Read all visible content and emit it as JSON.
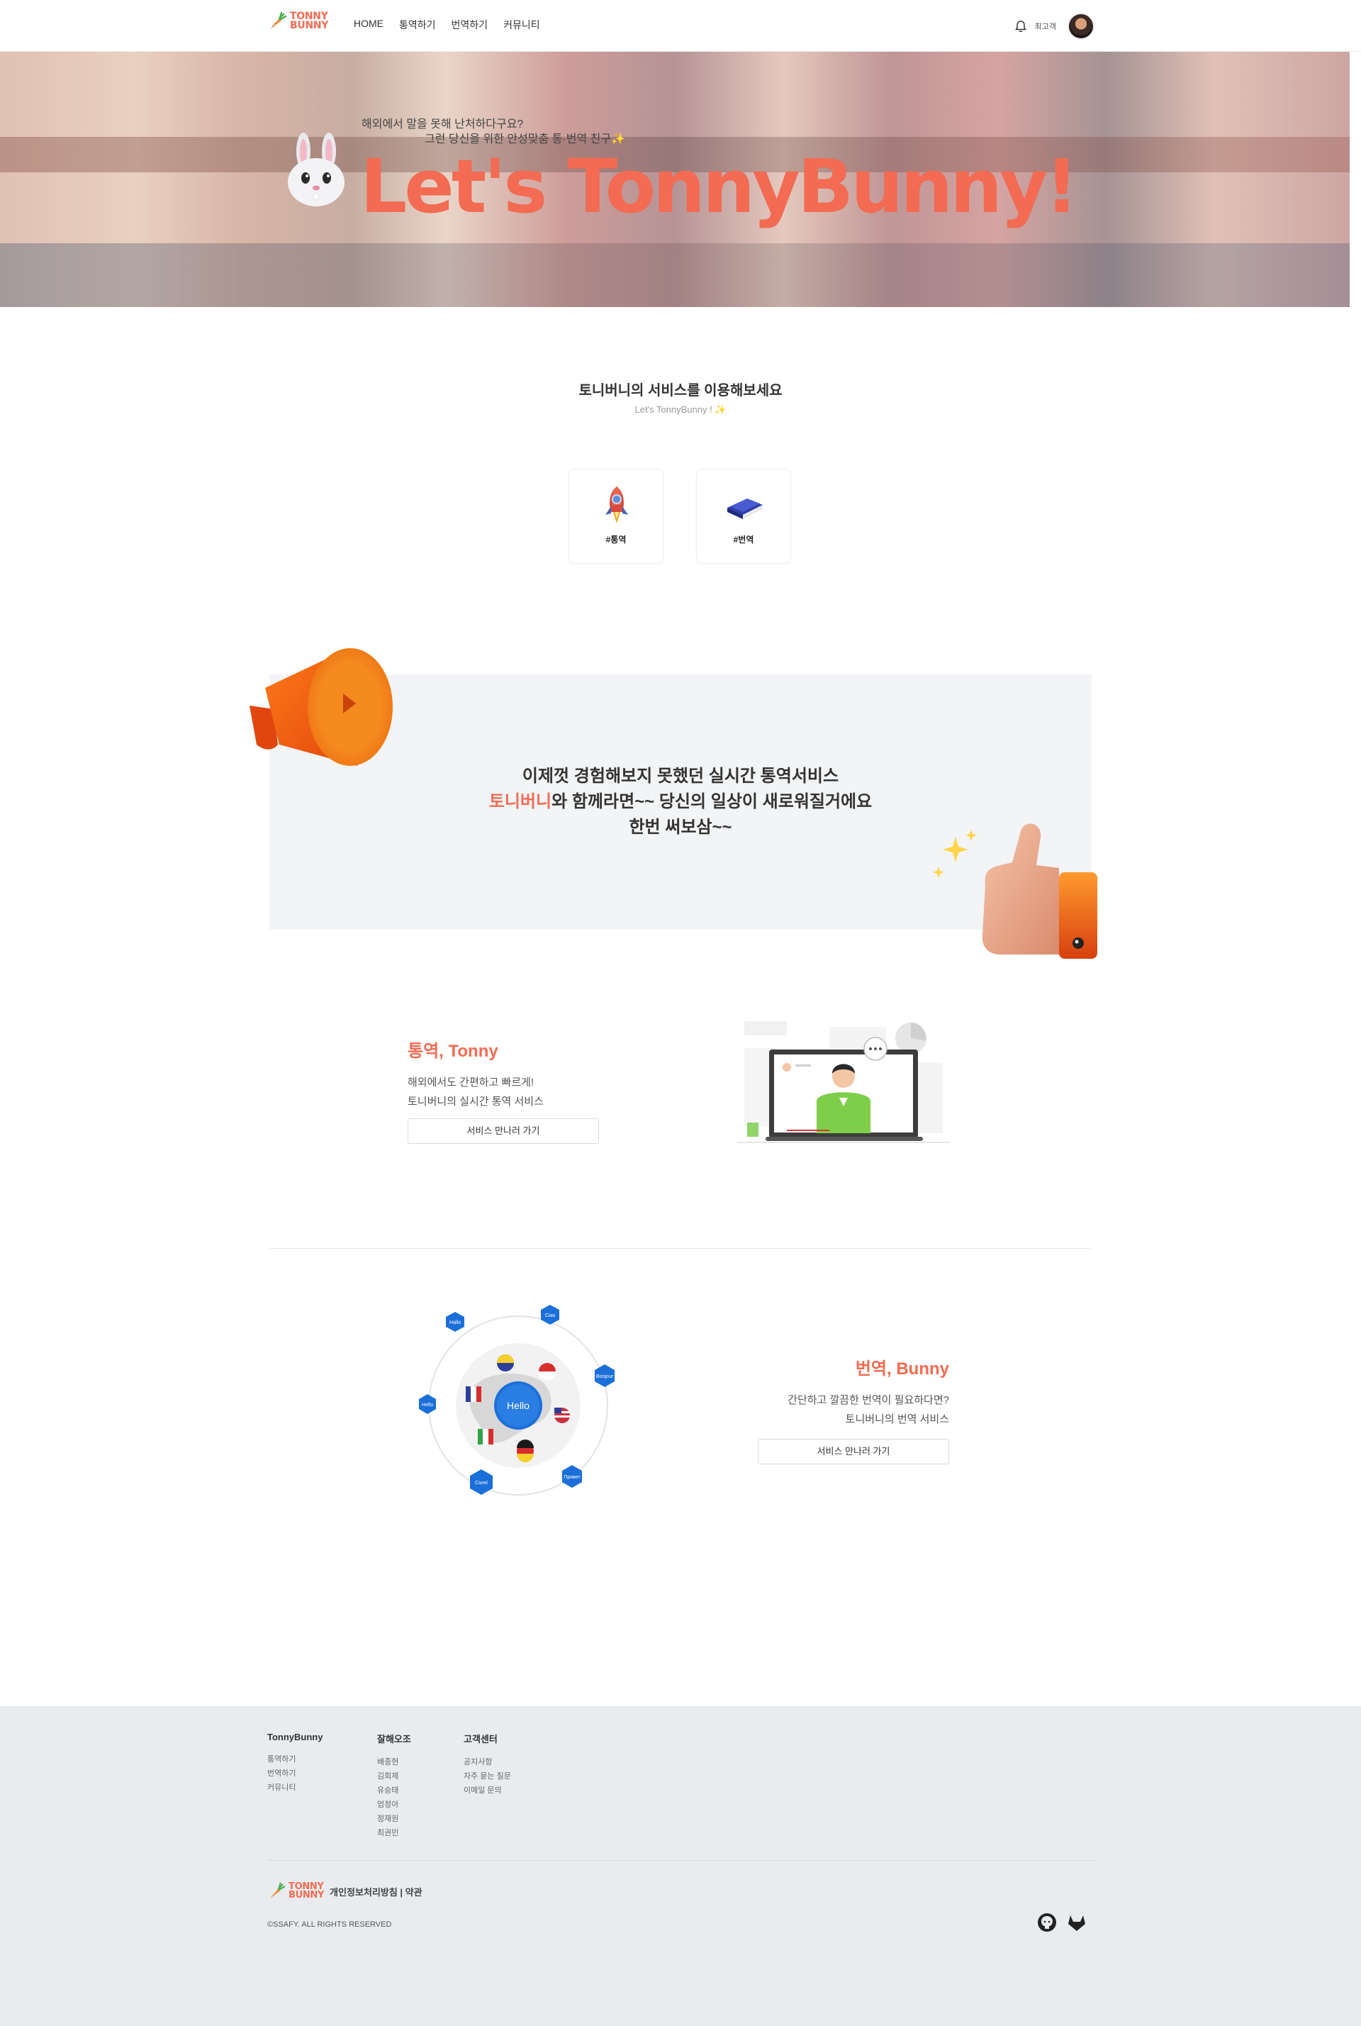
{
  "header": {
    "logo_line1": "TONNY",
    "logo_line2": "BUNNY",
    "nav": [
      "HOME",
      "통역하기",
      "번역하기",
      "커뮤니티"
    ],
    "user_name": "최고객"
  },
  "hero": {
    "subtitle_line1": "해외에서 말을 못해 난처하다구요?",
    "subtitle_line2": "그런 당신을 위한 안성맞춤 통·번역 친구✨",
    "title": "Let's TonnyBunny!"
  },
  "services": {
    "title": "토니버니의 서비스를 이용해보세요",
    "subtitle": "Let's TonnyBunny ! ✨",
    "cards": [
      {
        "label": "#통역",
        "icon": "rocket-icon"
      },
      {
        "label": "#번역",
        "icon": "book-icon"
      }
    ]
  },
  "promo": {
    "line1": "이제껏 경험해보지 못했던 실시간 통역서비스",
    "line2_accent": "토니버니",
    "line2_rest": "와 함께라면~~ 당신의 일상이 새로워질거에요",
    "line3": "한번 써보삼~~"
  },
  "tonny_section": {
    "title": "통역, Tonny",
    "desc_line1": "해외에서도 간편하고 빠르게!",
    "desc_line2": "토니버니의 실시간 통역 서비스",
    "button": "서비스 만나러 가기"
  },
  "bunny_section": {
    "title": "번역, Bunny",
    "desc_line1": "간단하고 깔끔한 번역이 필요하다면?",
    "desc_line2": "토니버니의 번역 서비스",
    "button": "서비스 만나러 가기",
    "globe_center": "Hello",
    "hex_labels": [
      "Hallo",
      "Ciao",
      "Bonjour",
      "Привет",
      "Ciumi",
      "Hello"
    ]
  },
  "footer": {
    "columns": [
      {
        "title": "TonnyBunny",
        "items": [
          "통역하기",
          "번역하기",
          "커뮤니티"
        ]
      },
      {
        "title": "잘해오조",
        "items": [
          "배종현",
          "김희제",
          "유승태",
          "엄정아",
          "정재원",
          "최권민"
        ]
      },
      {
        "title": "고객센터",
        "items": [
          "공지사항",
          "자주 묻는 질문",
          "이메일 문의"
        ]
      }
    ],
    "policy": "개인정보처리방침 | 약관",
    "copyright": "©SSAFY. ALL RIGHTS RESERVED"
  },
  "colors": {
    "accent": "#f26b52",
    "promo_bg": "#f2f4f6",
    "footer_bg": "#e9ecef",
    "globe_blue": "#1b6fd9"
  }
}
